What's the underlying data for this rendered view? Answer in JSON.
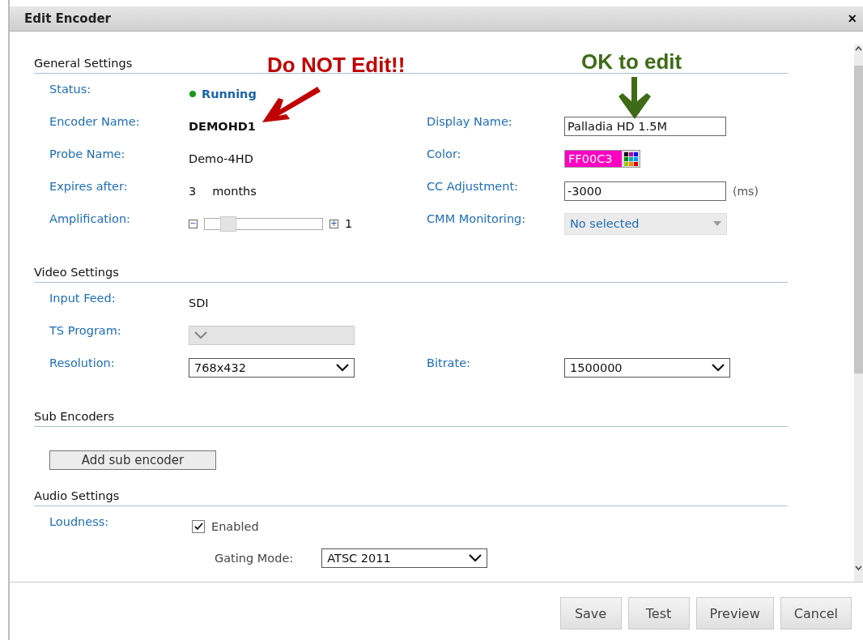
{
  "window": {
    "title": "Edit Encoder",
    "close": "×"
  },
  "annotations": [
    {
      "kind": "warning",
      "text": "Do NOT Edit!!"
    },
    {
      "kind": "ok",
      "text": "OK to edit"
    }
  ],
  "sections": [
    {
      "title": "General Settings",
      "rows": [
        {
          "left": {
            "label": "Status:",
            "kind": "status",
            "value": "Running"
          }
        },
        {
          "left": {
            "label": "Encoder Name:",
            "kind": "bold",
            "value": "DEMOHD1"
          },
          "right": {
            "label": "Display Name:",
            "kind": "input",
            "value": "Palladia HD 1.5M"
          }
        },
        {
          "left": {
            "label": "Probe Name:",
            "kind": "text",
            "value": "Demo-4HD"
          },
          "right": {
            "label": "Color:",
            "kind": "color",
            "value": "FF00C3",
            "color": "#ff00c3"
          }
        },
        {
          "left": {
            "label": "Expires after:",
            "kind": "expires",
            "value": "3",
            "unit": "months"
          },
          "right": {
            "label": "CC Adjustment:",
            "kind": "input",
            "value": "-3000",
            "unit": "(ms)"
          }
        },
        {
          "left": {
            "label": "Amplification:",
            "kind": "slider",
            "level": 0.2,
            "minus": "−",
            "plus": "+",
            "value": "1"
          },
          "right": {
            "label": "CMM Monitoring:",
            "kind": "select",
            "value": "No selected",
            "disabled": true
          }
        }
      ]
    },
    {
      "title": "Video Settings",
      "rows": [
        {
          "left": {
            "label": "Input Feed:",
            "kind": "text",
            "value": "SDI"
          }
        },
        {
          "left": {
            "label": "TS Program:",
            "kind": "dropdown",
            "disabled": true
          }
        },
        {
          "left": {
            "label": "Resolution:",
            "kind": "dropdown",
            "value": "768x432",
            "disabled": false
          },
          "right": {
            "label": "Bitrate:",
            "kind": "dropdown",
            "value": "1500000",
            "disabled": false
          }
        }
      ]
    },
    {
      "title": "Sub Encoders",
      "rows": [
        {
          "left": {
            "kind": "button",
            "value": "Add sub encoder"
          }
        }
      ]
    },
    {
      "title": "Audio Settings",
      "rows": [
        {
          "left": {
            "label": "Loudness:",
            "kind": "checkbox",
            "value": "Enabled",
            "checked": true
          }
        },
        {
          "left": {
            "kind": "subselect",
            "label": "Gating Mode:",
            "value": "ATSC 2011",
            "disabled": false
          }
        }
      ]
    }
  ],
  "buttons": [
    "Save",
    "Test",
    "Preview",
    "Cancel"
  ]
}
